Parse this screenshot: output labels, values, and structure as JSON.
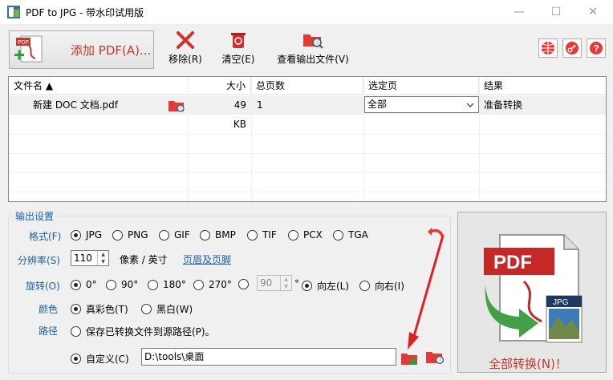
{
  "window": {
    "title": "PDF to JPG - 带水印试用版",
    "minimize": "—",
    "maximize": "☐",
    "close": "✕"
  },
  "toolbar": {
    "add_pdf": "添加 PDF(A)...",
    "remove": "移除(R)",
    "clear": "清空(E)",
    "view_output": "查看输出文件(V)"
  },
  "table": {
    "columns": [
      "文件名 ▲",
      "大小",
      "总页数",
      "选定页",
      "结果"
    ],
    "rows": [
      {
        "name": "新建 DOC 文档.pdf",
        "size": "49 KB",
        "pages": "1",
        "selected": "全部",
        "result": "准备转换"
      }
    ]
  },
  "settings": {
    "legend": "输出设置",
    "format_label": "格式(F)",
    "formats": [
      "JPG",
      "PNG",
      "GIF",
      "BMP",
      "TIF",
      "PCX",
      "TGA"
    ],
    "format_selected": "JPG",
    "resolution_label": "分辨率(S)",
    "resolution_value": "110",
    "resolution_unit": "像素 / 英寸",
    "header_footer_link": "页眉及页脚",
    "rotate_label": "旋转(O)",
    "rotations": [
      "0°",
      "90°",
      "180°",
      "270°",
      "°"
    ],
    "rotation_selected": "0°",
    "custom_angle": "90",
    "rotate_left": "向左(L)",
    "rotate_right": "向右(I)",
    "color_label": "颜色",
    "color_options": [
      "真彩色(T)",
      "黑白(W)"
    ],
    "color_selected": "真彩色(T)",
    "path_label": "路径",
    "save_to_source": "保存已转换文件到源路径(P)。",
    "custom_label": "自定义(C)",
    "custom_path": "D:\\tools\\桌面"
  },
  "convert": {
    "label": "全部转换(N)！",
    "pdf_text": "PDF",
    "jpg_text": "JPG"
  },
  "colors": {
    "accent_red": "#c0392b",
    "label_blue": "#1a5fa8",
    "window_bg": "#f0f0f0"
  }
}
